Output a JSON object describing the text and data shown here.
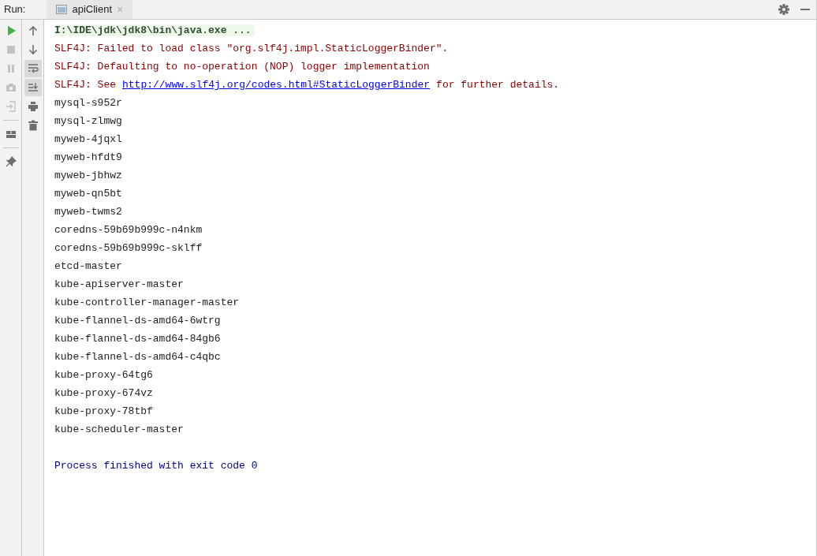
{
  "header": {
    "label": "Run:",
    "tabs": [
      {
        "label": "apiClient",
        "close": "×",
        "selected": true
      }
    ]
  },
  "run_toolbar": [
    {
      "kind": "run",
      "disabled": false
    },
    {
      "kind": "stop",
      "disabled": true
    },
    {
      "kind": "pause",
      "disabled": true
    },
    {
      "kind": "camera",
      "disabled": true
    },
    {
      "kind": "exit",
      "disabled": true
    },
    {
      "kind": "separator"
    },
    {
      "kind": "layout",
      "disabled": false
    },
    {
      "kind": "separator"
    },
    {
      "kind": "pin",
      "disabled": false
    }
  ],
  "console_toolbar": [
    {
      "kind": "up",
      "on": false
    },
    {
      "kind": "down",
      "on": false
    },
    {
      "kind": "wrap",
      "on": true
    },
    {
      "kind": "scroll_end",
      "on": true
    },
    {
      "kind": "print",
      "on": false
    },
    {
      "kind": "trash",
      "on": false
    }
  ],
  "console": [
    {
      "kind": "command",
      "text": "I:\\IDE\\jdk\\jdk8\\bin\\java.exe ..."
    },
    {
      "kind": "error",
      "text": "SLF4J: Failed to load class \"org.slf4j.impl.StaticLoggerBinder\"."
    },
    {
      "kind": "error",
      "text": "SLF4J: Defaulting to no-operation (NOP) logger implementation"
    },
    {
      "kind": "error_link",
      "text": "SLF4J: See",
      "link": "http://www.slf4j.org/codes.html#StaticLoggerBinder",
      "after": "for further details."
    },
    {
      "kind": "plain",
      "text": "mysql-s952r"
    },
    {
      "kind": "plain",
      "text": "mysql-zlmwg"
    },
    {
      "kind": "plain",
      "text": "myweb-4jqxl"
    },
    {
      "kind": "plain",
      "text": "myweb-hfdt9"
    },
    {
      "kind": "plain",
      "text": "myweb-jbhwz"
    },
    {
      "kind": "plain",
      "text": "myweb-qn5bt"
    },
    {
      "kind": "plain",
      "text": "myweb-twms2"
    },
    {
      "kind": "plain",
      "text": "coredns-59b69b999c-n4nkm"
    },
    {
      "kind": "plain",
      "text": "coredns-59b69b999c-sklff"
    },
    {
      "kind": "plain",
      "text": "etcd-master"
    },
    {
      "kind": "plain",
      "text": "kube-apiserver-master"
    },
    {
      "kind": "plain",
      "text": "kube-controller-manager-master"
    },
    {
      "kind": "plain",
      "text": "kube-flannel-ds-amd64-6wtrg"
    },
    {
      "kind": "plain",
      "text": "kube-flannel-ds-amd64-84gb6"
    },
    {
      "kind": "plain",
      "text": "kube-flannel-ds-amd64-c4qbc"
    },
    {
      "kind": "plain",
      "text": "kube-proxy-64tg6"
    },
    {
      "kind": "plain",
      "text": "kube-proxy-674vz"
    },
    {
      "kind": "plain",
      "text": "kube-proxy-78tbf"
    },
    {
      "kind": "plain",
      "text": "kube-scheduler-master"
    },
    {
      "kind": "system",
      "text": "Process finished with exit code 0"
    }
  ]
}
